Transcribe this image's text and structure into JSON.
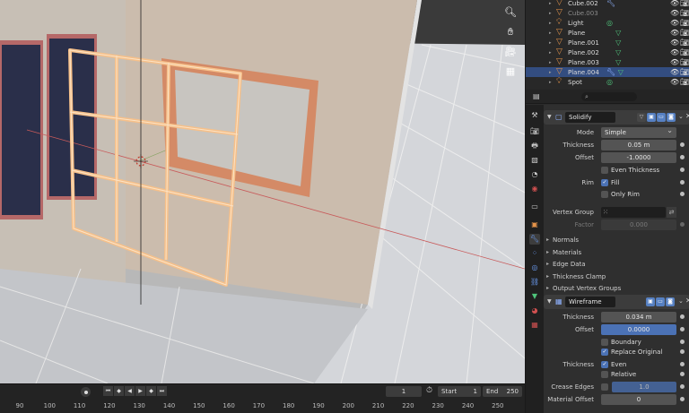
{
  "viewport": {
    "tool_icons": [
      "zoom-icon",
      "hand-icon",
      "camera-icon",
      "grid-icon"
    ]
  },
  "outliner": {
    "rows": [
      {
        "name": "Cube.002",
        "extra": "wrench",
        "dim": false,
        "selected": false
      },
      {
        "name": "Cube.003",
        "extra": "",
        "dim": true,
        "selected": false
      },
      {
        "name": "Light",
        "extra": "light",
        "dim": false,
        "selected": false
      },
      {
        "name": "Plane",
        "extra": "mesh",
        "dim": false,
        "selected": false
      },
      {
        "name": "Plane.001",
        "extra": "mesh",
        "dim": false,
        "selected": false
      },
      {
        "name": "Plane.002",
        "extra": "mesh",
        "dim": false,
        "selected": false
      },
      {
        "name": "Plane.003",
        "extra": "mesh",
        "dim": false,
        "selected": false
      },
      {
        "name": "Plane.004",
        "extra": "wrench mesh",
        "dim": false,
        "selected": true
      },
      {
        "name": "Spot",
        "extra": "light",
        "dim": false,
        "selected": false
      }
    ]
  },
  "properties": {
    "search_placeholder": "",
    "solidify": {
      "name": "Solidify",
      "mode_label": "Mode",
      "mode_value": "Simple",
      "thickness_label": "Thickness",
      "thickness_value": "0.05 m",
      "offset_label": "Offset",
      "offset_value": "-1.0000",
      "even_thickness_label": "Even Thickness",
      "even_thickness_checked": false,
      "rim_label": "Rim",
      "fill_label": "Fill",
      "fill_checked": true,
      "only_rim_label": "Only Rim",
      "only_rim_checked": false,
      "vertex_group_label": "Vertex Group",
      "vertex_group_value": "",
      "factor_label": "Factor",
      "factor_value": "0.000",
      "subpanels": [
        "Normals",
        "Materials",
        "Edge Data",
        "Thickness Clamp",
        "Output Vertex Groups"
      ]
    },
    "wireframe": {
      "name": "Wireframe",
      "thickness_label": "Thickness",
      "thickness_value": "0.034 m",
      "offset_label": "Offset",
      "offset_value": "0.0000",
      "boundary_label": "Boundary",
      "boundary_checked": false,
      "replace_original_label": "Replace Original",
      "replace_original_checked": true,
      "thickness2_label": "Thickness",
      "even_label": "Even",
      "even_checked": true,
      "relative_label": "Relative",
      "relative_checked": false,
      "crease_edges_label": "Crease Edges",
      "crease_value": "1.0",
      "material_offset_label": "Material Offset",
      "material_offset_value": "0"
    }
  },
  "timeline": {
    "current_frame": "1",
    "start_label": "Start",
    "start_value": "1",
    "end_label": "End",
    "end_value": "250",
    "ticks": [
      "90",
      "100",
      "110",
      "120",
      "130",
      "140",
      "150",
      "160",
      "170",
      "180",
      "190",
      "200",
      "210",
      "220",
      "230",
      "240",
      "250"
    ]
  },
  "colors": {
    "selection": "#334d80",
    "accent_blue": "#4b72b5",
    "object_orange": "#e5944a",
    "mesh_green": "#4fc47b",
    "window_orange": "#f0b27a"
  }
}
